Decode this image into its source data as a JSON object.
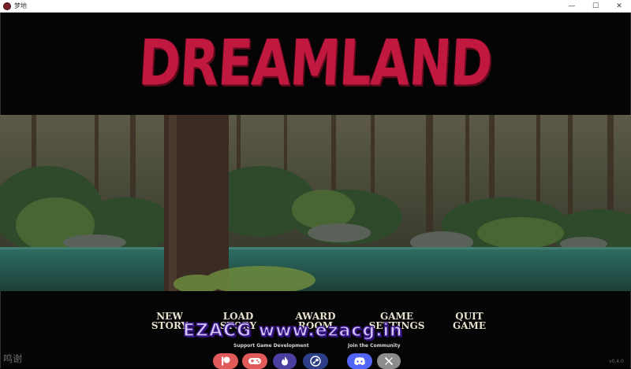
{
  "window": {
    "title": "梦地",
    "minimize": "—",
    "maximize": "☐",
    "close": "✕"
  },
  "logo": {
    "text": "DREAMLAND",
    "color": "#c0183f"
  },
  "menu": {
    "new_story": [
      "NEW",
      "STORY"
    ],
    "load_story": [
      "LOAD",
      "STORY"
    ],
    "award_room": [
      "AWARD",
      "ROOM"
    ],
    "game_settings": [
      "GAME",
      "SETTINGS"
    ],
    "quit_game": [
      "QUIT",
      "GAME"
    ]
  },
  "watermark": "EZACG www.ezacg.in",
  "support": {
    "label": "Support Game Development"
  },
  "community": {
    "label": "Join the Community"
  },
  "social_icons": [
    "patreon-icon",
    "gamepad-icon",
    "flame-icon",
    "steam-icon",
    "discord-icon",
    "x-icon"
  ],
  "bottom_left_text": "鸣谢",
  "version": "v0.4.0"
}
